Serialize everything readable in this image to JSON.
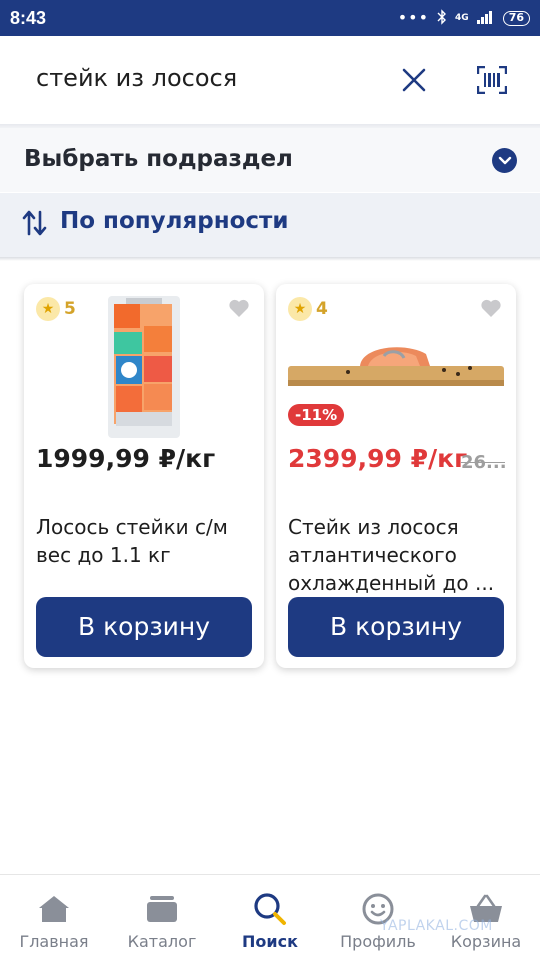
{
  "status_bar": {
    "time": "8:43",
    "network": "4G",
    "battery": "76"
  },
  "search": {
    "query": "стейк из лосося",
    "clear_icon": "close-icon",
    "scan_icon": "barcode-scan-icon"
  },
  "subsection": {
    "label": "Выбрать подраздел",
    "icon": "chevron-down-icon"
  },
  "sort": {
    "label": "По популярности",
    "icon": "sort-arrows-icon"
  },
  "products": [
    {
      "rating": "5",
      "price": "1999,99 ₽/кг",
      "name": "Лосось  стейки с/м вес до 1.1 кг",
      "cart_label": "В корзину"
    },
    {
      "rating": "4",
      "discount": "-11%",
      "price": "2399,99 ₽/кг",
      "old_price": "26...",
      "name": "Стейк из лосося атлантического охлажденный до ...",
      "cart_label": "В корзину"
    }
  ],
  "bottom_nav": [
    {
      "label": "Главная",
      "icon": "home-icon"
    },
    {
      "label": "Каталог",
      "icon": "catalog-icon"
    },
    {
      "label": "Поиск",
      "icon": "search-icon",
      "active": true
    },
    {
      "label": "Профиль",
      "icon": "profile-smile-icon"
    },
    {
      "label": "Корзина",
      "icon": "basket-icon"
    }
  ],
  "watermark": "YAPLAKAL.COM",
  "colors": {
    "brand_blue": "#1e3a82",
    "sale_red": "#e0393a",
    "rating_gold": "#d4a32a"
  }
}
